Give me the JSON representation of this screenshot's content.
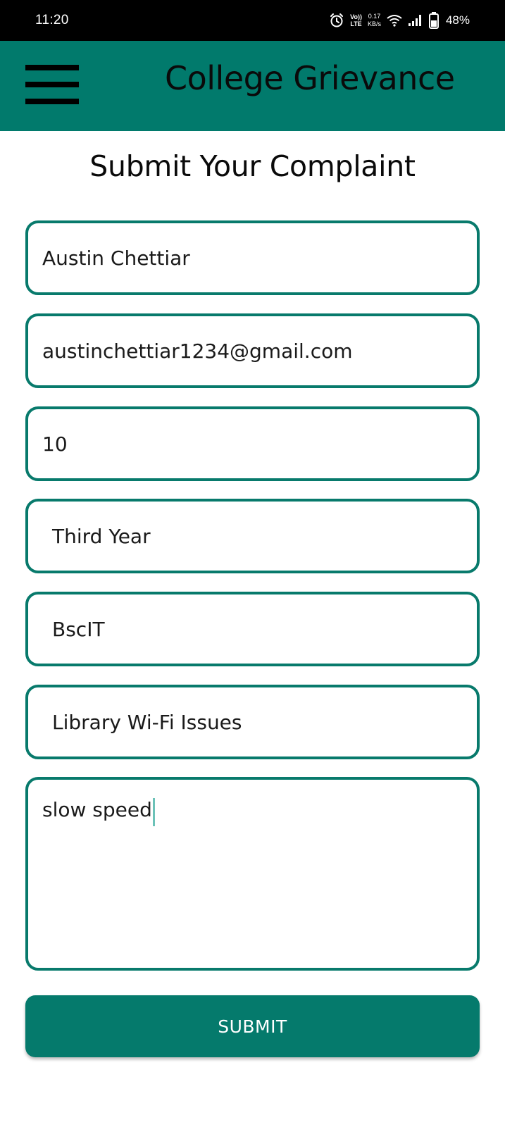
{
  "status_bar": {
    "time": "11:20",
    "volte_top": "Vo))",
    "volte_bottom": "LTE",
    "net_speed_value": "0.17",
    "net_speed_unit": "KB/s",
    "battery": "48%",
    "icons": [
      "alarm-icon",
      "volte-icon",
      "wifi-icon",
      "signal-icon",
      "battery-icon"
    ]
  },
  "app_bar": {
    "menu_icon": "hamburger-menu-icon",
    "title": "College Grievance",
    "background": "#017a6c"
  },
  "page_title": "Submit Your  Complaint",
  "form": {
    "name": "Austin Chettiar",
    "email": "austinchettiar1234@gmail.com",
    "roll_number": "10",
    "year": "Third Year",
    "course": "BscIT",
    "category": "Library Wi-Fi Issues",
    "description": "slow speed",
    "border_color": "#087a6c"
  },
  "submit": {
    "label": "SUBMIT",
    "color": "#057a6c"
  }
}
